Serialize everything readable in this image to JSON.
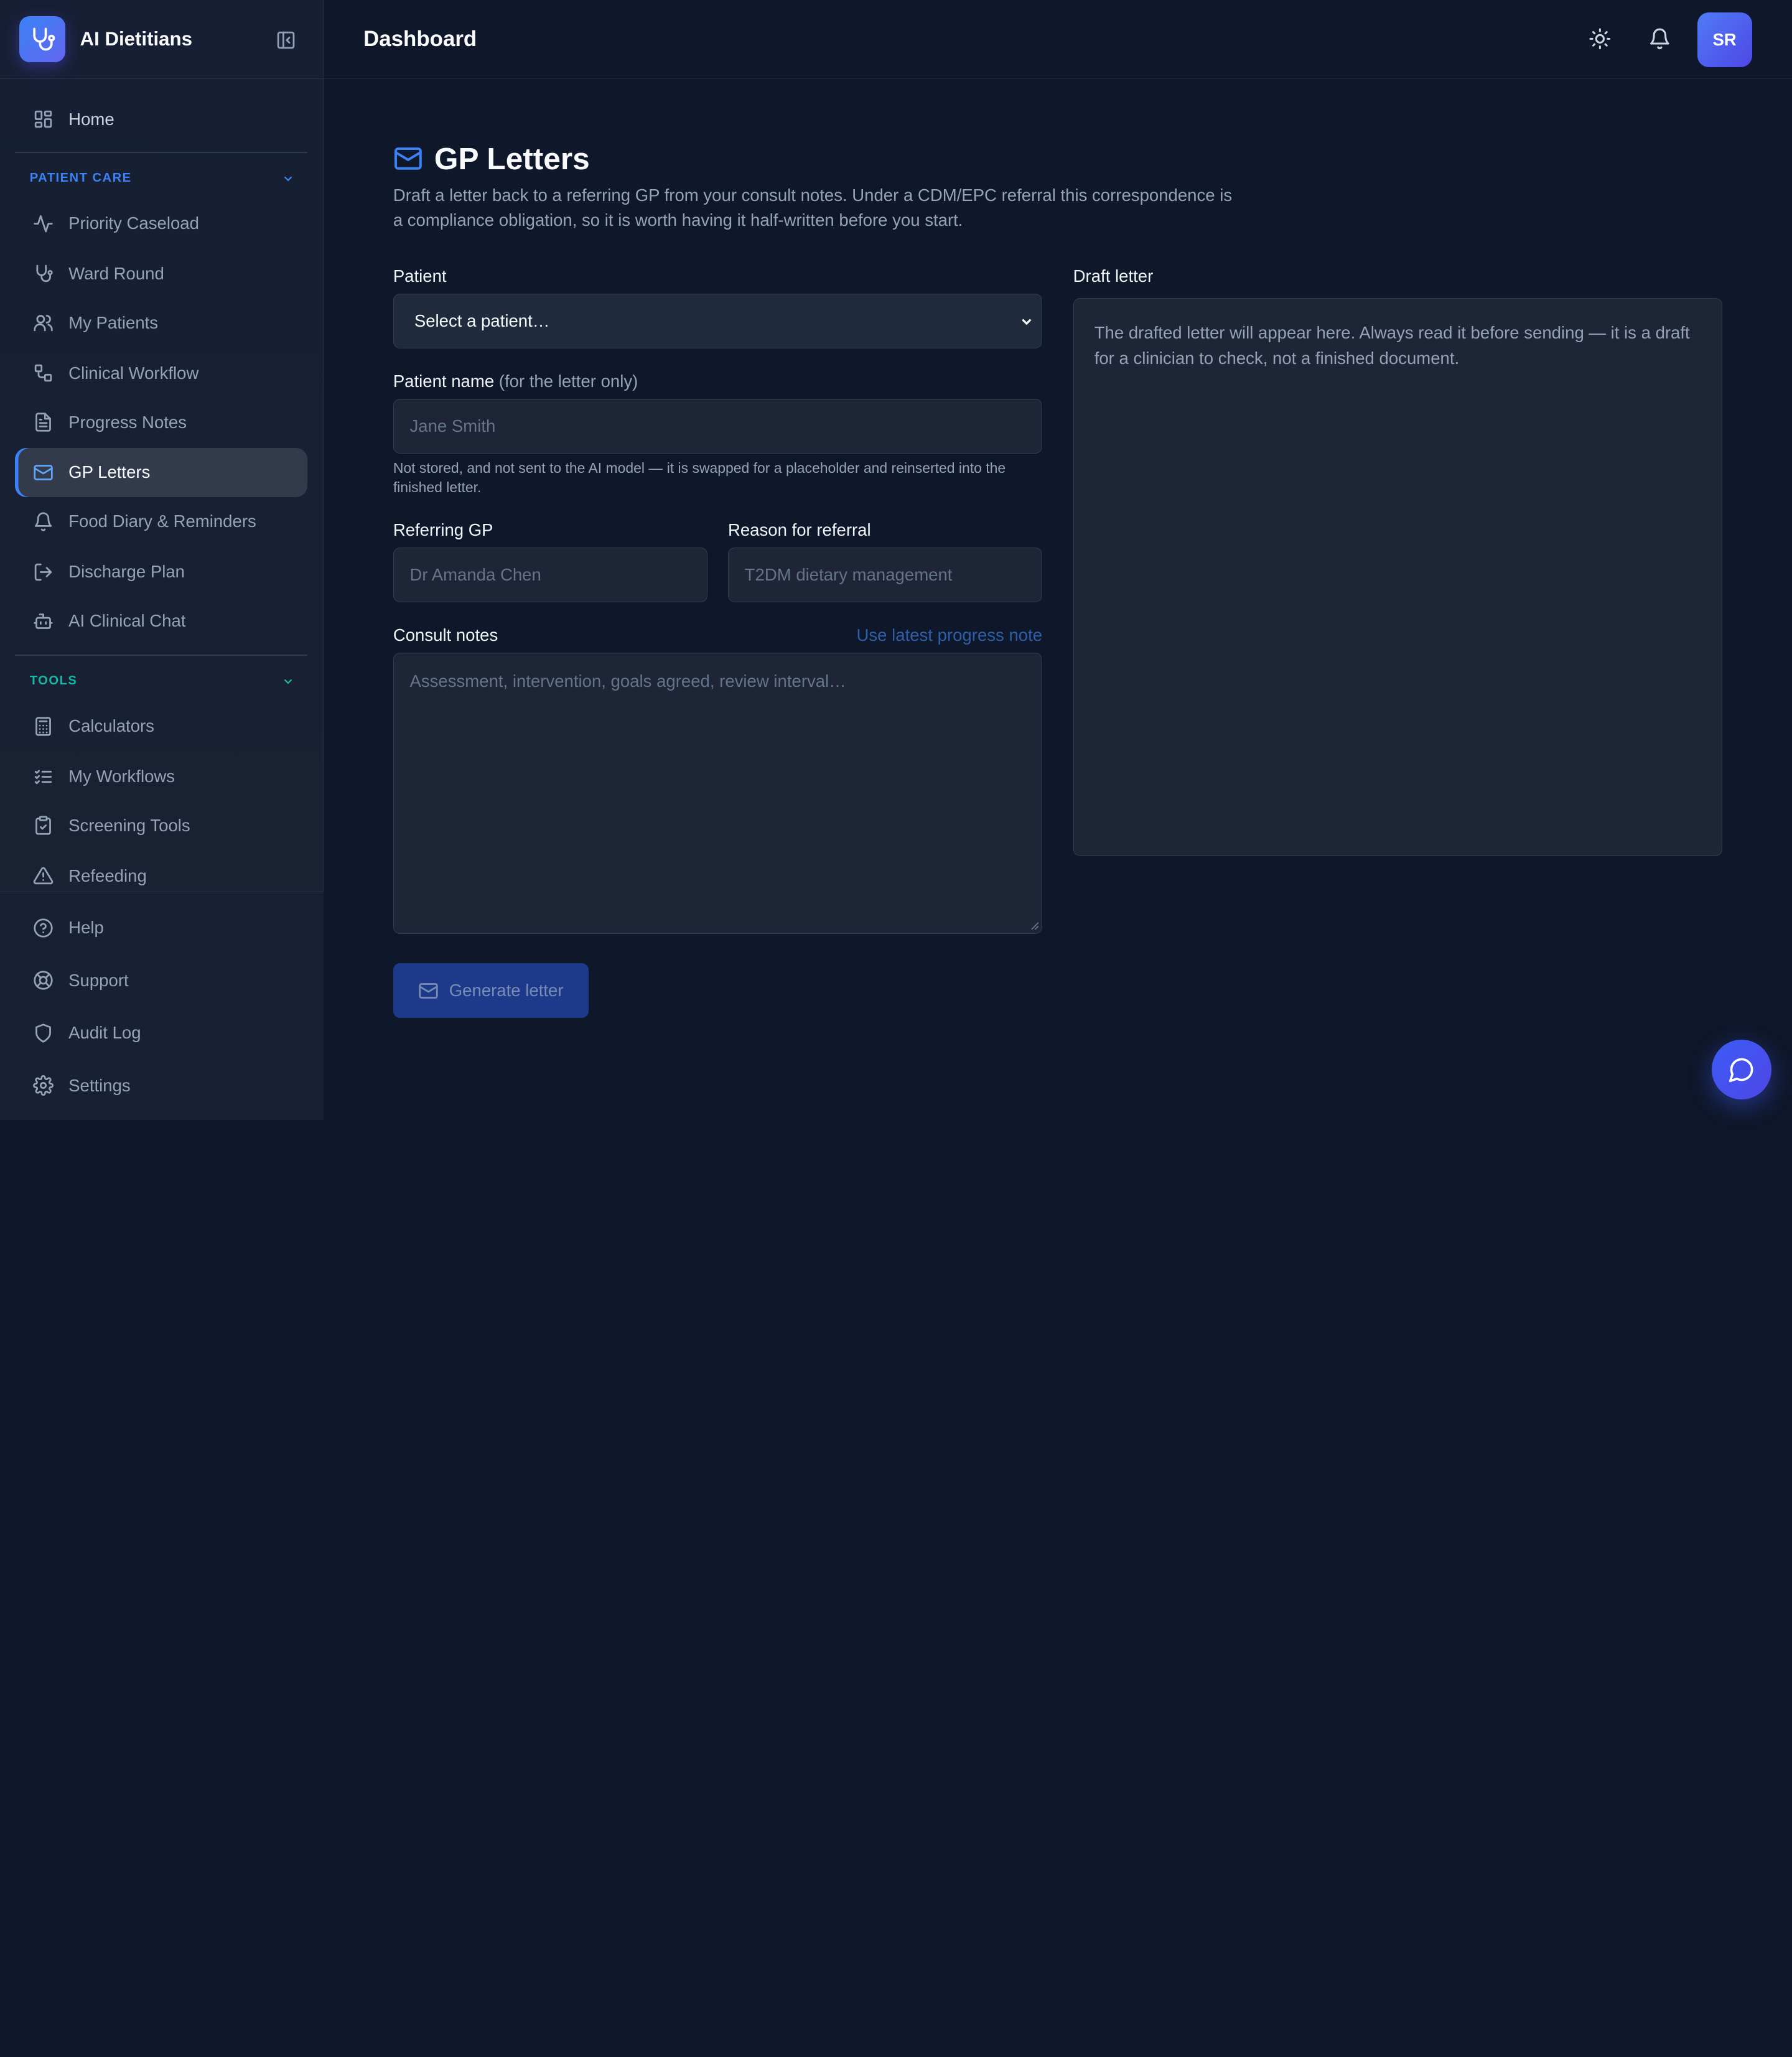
{
  "brand": {
    "name": "AI Dietitians",
    "icon": "stethoscope-icon"
  },
  "topbar": {
    "title": "Dashboard",
    "avatar_initials": "SR"
  },
  "sidebar": {
    "home": "Home",
    "patient_care": {
      "heading": "PATIENT CARE",
      "items": [
        "Priority Caseload",
        "Ward Round",
        "My Patients",
        "Clinical Workflow",
        "Progress Notes",
        "GP Letters",
        "Food Diary & Reminders",
        "Discharge Plan",
        "AI Clinical Chat"
      ],
      "active": "GP Letters"
    },
    "tools": {
      "heading": "TOOLS",
      "items": [
        "Calculators",
        "My Workflows",
        "Screening Tools",
        "Refeeding"
      ]
    },
    "bottom": [
      "Help",
      "Support",
      "Audit Log",
      "Settings"
    ]
  },
  "page": {
    "title": "GP Letters",
    "description": "Draft a letter back to a referring GP from your consult notes. Under a CDM/EPC referral this correspondence is a compliance obligation, so it is worth having it half-written before you start."
  },
  "form": {
    "patient_label": "Patient",
    "patient_select": "Select a patient…",
    "patient_name_label": "Patient name",
    "patient_name_label_suffix": "(for the letter only)",
    "patient_name_placeholder": "Jane Smith",
    "patient_name_hint": "Not stored, and not sent to the AI model — it is swapped for a placeholder and reinserted into the finished letter.",
    "referring_gp_label": "Referring GP",
    "referring_gp_placeholder": "Dr Amanda Chen",
    "reason_label": "Reason for referral",
    "reason_placeholder": "T2DM dietary management",
    "consult_label": "Consult notes",
    "consult_link": "Use latest progress note",
    "consult_placeholder": "Assessment, intervention, goals agreed, review interval…",
    "generate_button": "Generate letter"
  },
  "draft": {
    "label": "Draft letter",
    "placeholder": "The drafted letter will appear here. Always read it before sending — it is a draft for a clinician to check, not a finished document."
  },
  "colors": {
    "accent": "#3b82f6",
    "tools_accent": "#14b8a6",
    "background": "#0f172a"
  }
}
